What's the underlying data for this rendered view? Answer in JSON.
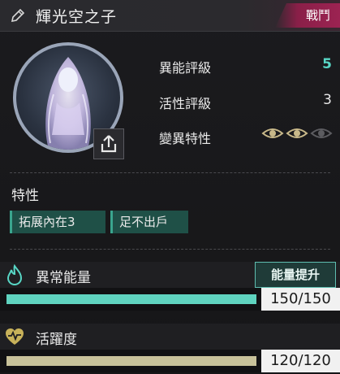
{
  "header": {
    "name": "輝光空之子",
    "tag": "戰鬥"
  },
  "stats": [
    {
      "label": "異能評級",
      "value": "5"
    },
    {
      "label": "活性評級",
      "value": "3"
    },
    {
      "label": "變異特性",
      "value": ""
    }
  ],
  "mutation_eyes": {
    "active": 2,
    "total": 3
  },
  "traits": {
    "title": "特性",
    "items": [
      "拓展內在3",
      "足不出戶"
    ]
  },
  "energy": {
    "label": "異常能量",
    "boost_label": "能量提升",
    "value_text": "150/150",
    "fill_fraction": 1.0,
    "bar_color": "#5fd3bf"
  },
  "activity": {
    "label": "活躍度",
    "value_text": "120/120",
    "fill_fraction": 1.0,
    "bar_color": "#c8c29a"
  },
  "colors": {
    "accent_cyan": "#58d7c6",
    "tag_red": "#9c2352",
    "gold_eye": "#c9b98a"
  }
}
